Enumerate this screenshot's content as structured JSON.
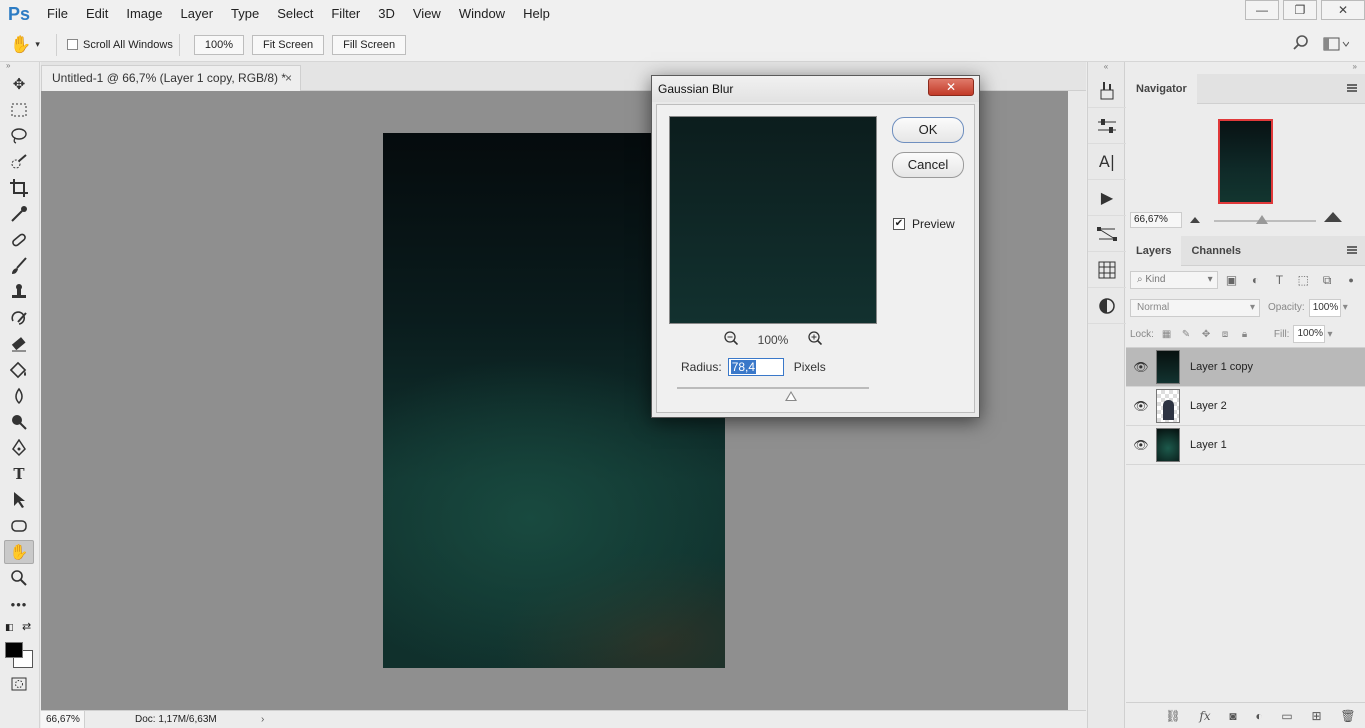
{
  "app": {
    "logo": "Ps"
  },
  "menu": [
    "File",
    "Edit",
    "Image",
    "Layer",
    "Type",
    "Select",
    "Filter",
    "3D",
    "View",
    "Window",
    "Help"
  ],
  "window_controls": {
    "minimize": "—",
    "restore": "❐",
    "close": "✕"
  },
  "options": {
    "scroll_all": "Scroll All Windows",
    "zoom_100": "100%",
    "fit_screen": "Fit Screen",
    "fill_screen": "Fill Screen"
  },
  "document": {
    "tab_title": "Untitled-1 @ 66,7% (Layer 1 copy, RGB/8) *",
    "tab_close": "×"
  },
  "status": {
    "zoom": "66,67%",
    "doc": "Doc: 1,17M/6,63M",
    "arrow": "›"
  },
  "navigator": {
    "title": "Navigator",
    "zoom": "66,67%"
  },
  "layers": {
    "tabs": [
      "Layers",
      "Channels"
    ],
    "kind": "Kind",
    "blend": "Normal",
    "opacity_label": "Opacity:",
    "opacity": "100%",
    "lock_label": "Lock:",
    "fill_label": "Fill:",
    "fill": "100%",
    "items": [
      {
        "name": "Layer 1 copy"
      },
      {
        "name": "Layer 2"
      },
      {
        "name": "Layer 1"
      }
    ]
  },
  "dialog": {
    "title": "Gaussian Blur",
    "close": "✕",
    "ok": "OK",
    "cancel": "Cancel",
    "preview_label": "Preview",
    "preview_checked": true,
    "zoom": "100%",
    "radius_label": "Radius:",
    "radius_value": "78,4",
    "radius_unit": "Pixels"
  },
  "colors": {
    "accent": "#2d7cc4",
    "selection": "#3a78c9",
    "close_button": "#c23a28"
  }
}
